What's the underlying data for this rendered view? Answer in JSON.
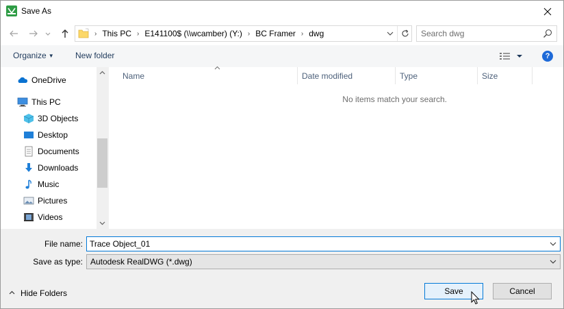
{
  "window": {
    "title": "Save As",
    "colors": {
      "accent": "#0078d7",
      "app_icon": "#2e9c45",
      "help": "#1e6ad8"
    }
  },
  "titlebar": {
    "close_icon": "close-icon"
  },
  "navigation": {
    "back_icon": "arrow-left-icon",
    "forward_icon": "arrow-right-icon",
    "recent_icon": "chevron-down-icon",
    "up_icon": "arrow-up-icon"
  },
  "address": {
    "crumbs": [
      "This PC",
      "E141100$ (\\\\wcamber) (Y:)",
      "BC Framer",
      "dwg"
    ],
    "separator": "›"
  },
  "search": {
    "placeholder": "Search dwg"
  },
  "toolbar": {
    "organize_label": "Organize",
    "new_folder_label": "New folder",
    "help_label": "?"
  },
  "sidebar": {
    "items": [
      {
        "label": "OneDrive",
        "icon": "onedrive-icon"
      },
      {
        "label": "This PC",
        "icon": "computer-icon"
      },
      {
        "label": "3D Objects",
        "icon": "cube-icon"
      },
      {
        "label": "Desktop",
        "icon": "desktop-icon"
      },
      {
        "label": "Documents",
        "icon": "document-icon"
      },
      {
        "label": "Downloads",
        "icon": "download-icon"
      },
      {
        "label": "Music",
        "icon": "music-icon"
      },
      {
        "label": "Pictures",
        "icon": "pictures-icon"
      },
      {
        "label": "Videos",
        "icon": "videos-icon"
      }
    ]
  },
  "filelist": {
    "columns": [
      "Name",
      "Date modified",
      "Type",
      "Size"
    ],
    "empty_message": "No items match your search."
  },
  "form": {
    "file_name_label": "File name:",
    "file_name_value": "Trace Object_01",
    "save_type_label": "Save as type:",
    "save_type_value": "Autodesk RealDWG (*.dwg)"
  },
  "footer": {
    "hide_folders_label": "Hide Folders",
    "save_label": "Save",
    "cancel_label": "Cancel"
  }
}
